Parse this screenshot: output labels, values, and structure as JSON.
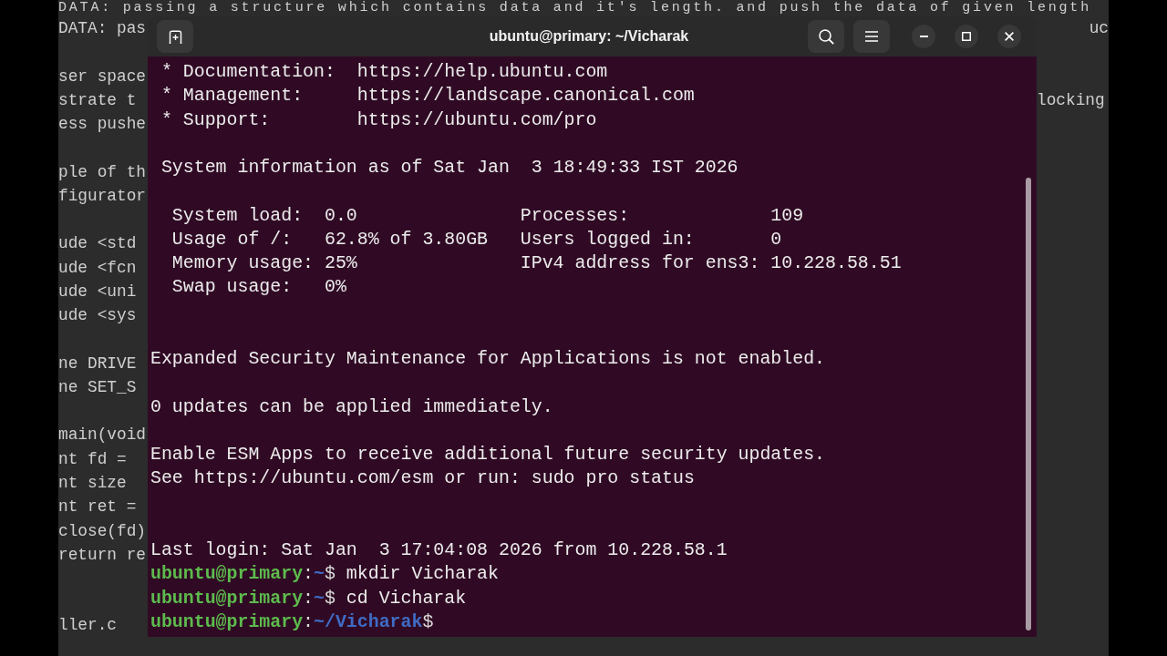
{
  "editor": {
    "top_line": "DATA: passing a structure which contains data and it's length. and push the data of given length",
    "left_column": [
      [
        "DATA: pas"
      ],
      [
        "ser space",
        "strate t",
        "ess pushe"
      ],
      [
        "ple of th",
        "figurator"
      ],
      [
        "ude <std",
        "ude <fcn",
        "ude <uni",
        "ude <sys"
      ],
      [
        "ne DRIVE",
        "ne SET_S"
      ],
      [
        "main(void",
        "nt fd =",
        "nt size",
        "nt ret =",
        "close(fd)",
        "return re"
      ],
      [
        "ller.c"
      ]
    ],
    "right_column": [
      "uc",
      "locking"
    ]
  },
  "terminal": {
    "title": "ubuntu@primary: ~/Vicharak",
    "motd_links": [
      {
        "label": "* Documentation:",
        "url": "https://help.ubuntu.com"
      },
      {
        "label": "* Management:",
        "url": "https://landscape.canonical.com"
      },
      {
        "label": "* Support:",
        "url": "https://ubuntu.com/pro"
      }
    ],
    "system_info_header": "System information as of Sat Jan  3 18:49:33 IST 2026",
    "system_info": [
      {
        "left": {
          "label": "System load:",
          "value": "0.0"
        },
        "right": {
          "label": "Processes:",
          "value": "109"
        }
      },
      {
        "left": {
          "label": "Usage of /:",
          "value": "62.8% of 3.80GB"
        },
        "right": {
          "label": "Users logged in:",
          "value": "0"
        }
      },
      {
        "left": {
          "label": "Memory usage:",
          "value": "25%"
        },
        "right": {
          "label": "IPv4 address for ens3:",
          "value": "10.228.58.51"
        }
      },
      {
        "left": {
          "label": "Swap usage:",
          "value": "0%"
        }
      }
    ],
    "notices": [
      [
        "Expanded Security Maintenance for Applications is not enabled."
      ],
      [
        "0 updates can be applied immediately."
      ],
      [
        "Enable ESM Apps to receive additional future security updates.",
        "See https://ubuntu.com/esm or run: sudo pro status"
      ]
    ],
    "last_login": "Last login: Sat Jan  3 17:04:08 2026 from 10.228.58.1",
    "prompts": [
      {
        "user_host": "ubuntu@primary",
        "separator": ":",
        "path": "~",
        "symbol": "$",
        "command": "mkdir Vicharak"
      },
      {
        "user_host": "ubuntu@primary",
        "separator": ":",
        "path": "~",
        "symbol": "$",
        "command": "cd Vicharak"
      },
      {
        "user_host": "ubuntu@primary",
        "separator": ":",
        "path": "~/Vicharak",
        "symbol": "$"
      }
    ]
  }
}
